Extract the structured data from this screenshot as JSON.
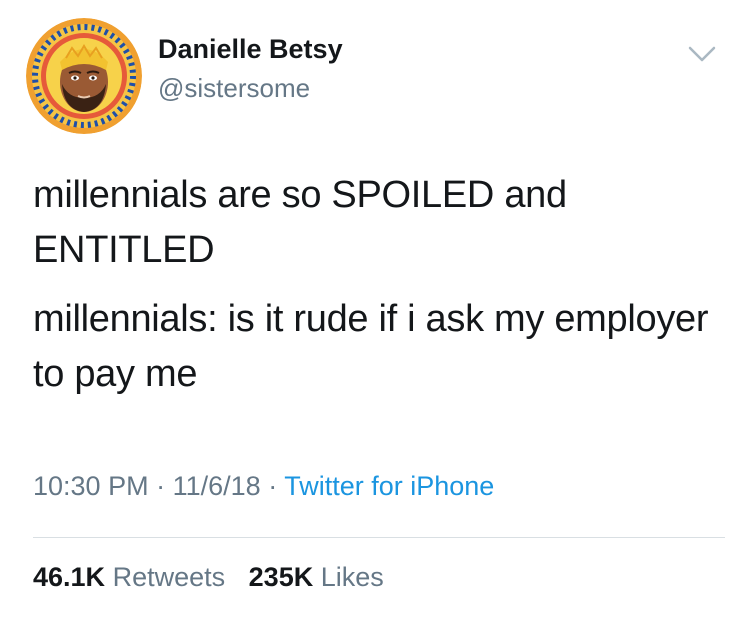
{
  "author": {
    "display_name": "Danielle Betsy",
    "handle": "@sistersome",
    "avatar_icon": "cartoon-portrait-avatar"
  },
  "tweet": {
    "paragraphs": [
      "millennials are so SPOILED and ENTITLED",
      "millennials: is it rude if i ask my employer to pay me"
    ],
    "time": "10:30 PM",
    "date": "11/6/18",
    "separator": "·",
    "source": "Twitter for iPhone"
  },
  "stats": {
    "retweets_count": "46.1K",
    "retweets_label": "Retweets",
    "likes_count": "235K",
    "likes_label": "Likes"
  },
  "colors": {
    "primary_text": "#14171a",
    "secondary_text": "#657786",
    "link": "#1b95e0",
    "divider": "#d9dfe3"
  }
}
